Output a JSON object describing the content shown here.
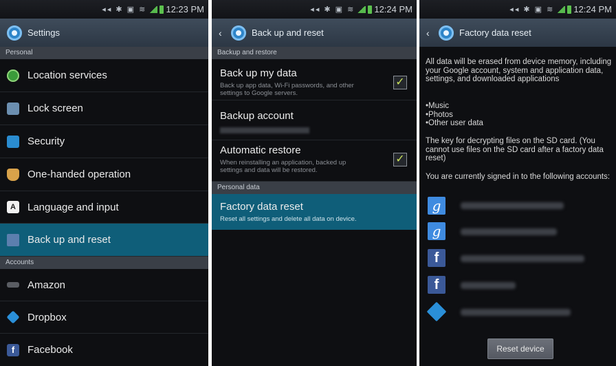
{
  "status_times": [
    "12:23 PM",
    "12:24 PM",
    "12:24 PM"
  ],
  "panel1": {
    "title": "Settings",
    "section_personal": "Personal",
    "items": [
      {
        "label": "Location services",
        "icon": "location-icon"
      },
      {
        "label": "Lock screen",
        "icon": "lock-screen-icon"
      },
      {
        "label": "Security",
        "icon": "security-icon"
      },
      {
        "label": "One-handed operation",
        "icon": "hand-icon"
      },
      {
        "label": "Language and input",
        "icon": "language-icon"
      },
      {
        "label": "Back up and reset",
        "icon": "backup-icon",
        "selected": true
      }
    ],
    "section_accounts": "Accounts",
    "accounts": [
      {
        "label": "Amazon",
        "icon": "amazon-icon"
      },
      {
        "label": "Dropbox",
        "icon": "dropbox-icon"
      },
      {
        "label": "Facebook",
        "icon": "facebook-icon"
      }
    ]
  },
  "panel2": {
    "title": "Back up and reset",
    "section_backup": "Backup and restore",
    "backup_my_data": {
      "label": "Back up my data",
      "summary": "Back up app data, Wi-Fi passwords, and other settings to Google servers.",
      "checked": true
    },
    "backup_account": {
      "label": "Backup account"
    },
    "automatic_restore": {
      "label": "Automatic restore",
      "summary": "When reinstalling an application, backed up settings and data will be restored.",
      "checked": true
    },
    "section_personal": "Personal data",
    "factory_reset": {
      "label": "Factory data reset",
      "summary": "Reset all settings and delete all data on device."
    }
  },
  "panel3": {
    "title": "Factory data reset",
    "warning": "All data will be erased from device memory, including your Google account, system and application data, settings, and downloaded applications",
    "bullets": [
      "Music",
      "Photos",
      "Other user data"
    ],
    "sd_note": "The key for decrypting files on the SD card. (You cannot use files on the SD card after a factory data reset)",
    "signed_in": "You are currently signed in to the following accounts:",
    "accounts": [
      "google",
      "google",
      "facebook",
      "facebook",
      "dropbox"
    ],
    "reset_button": "Reset device"
  },
  "colors": {
    "highlight": "#0f5e79",
    "titlebar": "#34404d",
    "section": "#3a3f47"
  }
}
